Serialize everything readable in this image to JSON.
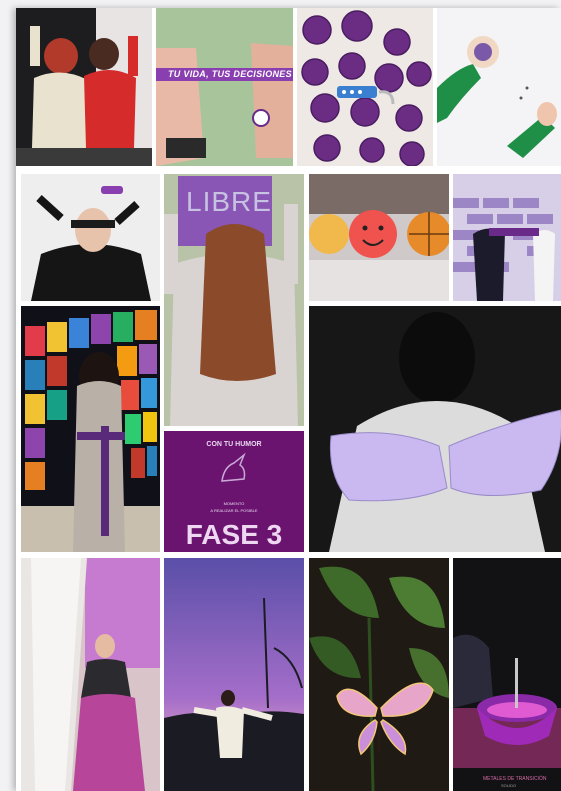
{
  "collage": {
    "banner_text": "TU VIDA, TUS DECISIONES",
    "poster_word": "LIBRE",
    "phase_card": {
      "heading": "CON TU HUMOR",
      "subline_1": "MOMENTO",
      "subline_2": "A REALIZAR EL POSIBLE",
      "title": "FASE 3"
    },
    "caption_last": "METALES DE TRANSICIÓN",
    "caption_last_sub": "SOLIDO",
    "colors": {
      "accent_purple": "#7b2b8f",
      "card_purple": "#6a1470",
      "lilac": "#c9b9f0"
    }
  }
}
